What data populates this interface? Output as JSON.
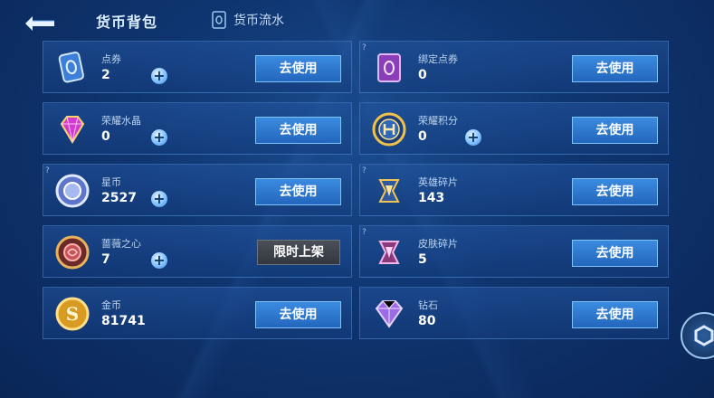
{
  "header": {
    "title": "货币背包",
    "flow_label": "货币流水"
  },
  "currencies": [
    {
      "name": "点券",
      "count": "2",
      "action": "去使用"
    },
    {
      "name": "绑定点券",
      "count": "0",
      "action": "去使用"
    },
    {
      "name": "荣耀水晶",
      "count": "0",
      "action": "去使用"
    },
    {
      "name": "荣耀积分",
      "count": "0",
      "action": "去使用"
    },
    {
      "name": "星币",
      "count": "2527",
      "action": "去使用"
    },
    {
      "name": "英雄碎片",
      "count": "143",
      "action": "去使用"
    },
    {
      "name": "蔷薇之心",
      "count": "7",
      "action": "限时上架"
    },
    {
      "name": "皮肤碎片",
      "count": "5",
      "action": "去使用"
    },
    {
      "name": "金币",
      "count": "81741",
      "action": "去使用"
    },
    {
      "name": "钻石",
      "count": "80",
      "action": "去使用"
    }
  ]
}
